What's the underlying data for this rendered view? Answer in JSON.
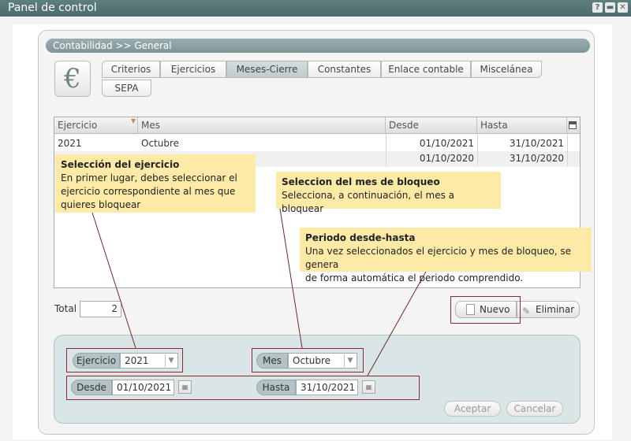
{
  "window": {
    "title": "Panel de control",
    "icons": [
      "?",
      "▬",
      "✕"
    ]
  },
  "breadcrumb": "Contabilidad >> General",
  "app_icon_glyph": "€",
  "tabs": [
    {
      "label": "Criterios",
      "active": false
    },
    {
      "label": "Ejercicios",
      "active": false
    },
    {
      "label": "Meses-Cierre",
      "active": true
    },
    {
      "label": "Constantes",
      "active": false
    },
    {
      "label": "Enlace contable",
      "active": false
    },
    {
      "label": "Miscelánea",
      "active": false
    },
    {
      "label": "SEPA",
      "active": false
    }
  ],
  "grid": {
    "columns": [
      "Ejercicio",
      "Mes",
      "Desde",
      "Hasta"
    ],
    "rows": [
      {
        "ejercicio": "2021",
        "mes": "Octubre",
        "desde": "01/10/2021",
        "hasta": "31/10/2021"
      },
      {
        "ejercicio": "",
        "mes": "",
        "desde": "01/10/2020",
        "hasta": "31/10/2020"
      }
    ]
  },
  "total": {
    "label": "Total",
    "value": "2"
  },
  "actions": {
    "nuevo": "Nuevo",
    "eliminar": "Eliminar"
  },
  "form": {
    "ejercicio": {
      "label": "Ejercicio",
      "value": "2021"
    },
    "mes": {
      "label": "Mes",
      "value": "Octubre"
    },
    "desde": {
      "label": "Desde",
      "value": "01/10/2021"
    },
    "hasta": {
      "label": "Hasta",
      "value": "31/10/2021"
    },
    "aceptar": "Aceptar",
    "cancelar": "Cancelar"
  },
  "callouts": [
    {
      "title": "Selección del ejercicio",
      "lines": [
        "En primer lugar, debes seleccionar el",
        "ejercicio correspondiente al mes que",
        "quieres bloquear"
      ]
    },
    {
      "title": "Seleccion del mes de bloqueo",
      "lines": [
        "Selecciona, a continuación, el mes a bloquear"
      ]
    },
    {
      "title": "Periodo desde-hasta",
      "lines": [
        "Una vez seleccionados el ejercicio y mes de bloqueo, se genera",
        "de forma automática el periodo comprendido."
      ]
    }
  ],
  "colors": {
    "titlebar": "#567677",
    "callout": "#fdeaa7",
    "highlight": "#8b2a2a",
    "form_bg": "#d9e5e6"
  }
}
